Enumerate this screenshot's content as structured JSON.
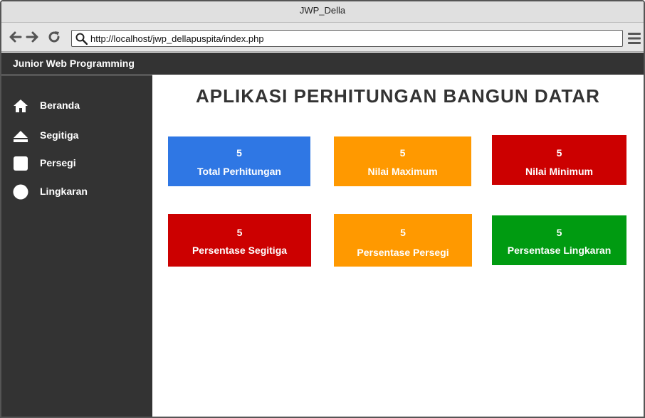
{
  "browser": {
    "title": "JWP_Della",
    "url": "http://localhost/jwp_dellapuspita/index.php"
  },
  "app": {
    "brand": "Junior Web Programming"
  },
  "sidebar": {
    "items": [
      {
        "label": "Beranda",
        "icon": "home-icon"
      },
      {
        "label": "Segitiga",
        "icon": "eject-triangle-icon"
      },
      {
        "label": "Persegi",
        "icon": "square-icon"
      },
      {
        "label": "Lingkaran",
        "icon": "circle-icon"
      }
    ]
  },
  "main": {
    "title": "APLIKASI PERHITUNGAN BANGUN DATAR",
    "cards": [
      {
        "value": "5",
        "label": "Total Perhitungan",
        "color": "#2f77e4"
      },
      {
        "value": "5",
        "label": "Nilai Maximum",
        "color": "#ff9900"
      },
      {
        "value": "5",
        "label": "Nilai Minimum",
        "color": "#cc0000"
      },
      {
        "value": "5",
        "label": "Persentase Segitiga",
        "color": "#cc0000"
      },
      {
        "value": "5",
        "label": "Persentase Persegi",
        "color": "#ff9900"
      },
      {
        "value": "5",
        "label": "Persentase Lingkaran",
        "color": "#009b11"
      }
    ]
  }
}
